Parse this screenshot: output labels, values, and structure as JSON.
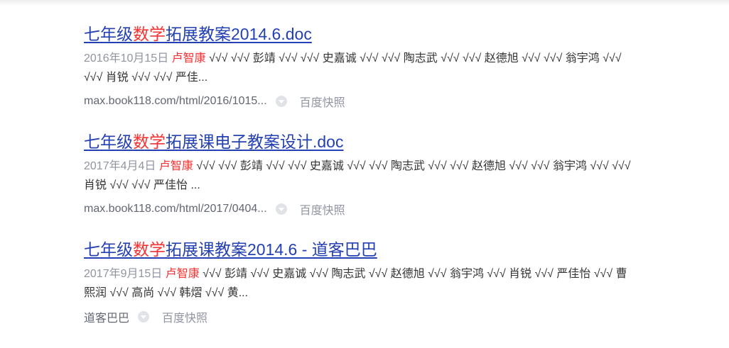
{
  "results": [
    {
      "title_pre": "七年级",
      "title_hl": "数学",
      "title_post": "拓展教案2014.6.doc",
      "date": "2016年10月15日",
      "author": "卢智康",
      "abstract": " √√√ √√√ 彭靖 √√√ √√√ 史嘉诚 √√√ √√√ 陶志武 √√√ √√√ 赵德旭 √√√ √√√ 翁宇鸿 √√√ √√√ 肖锐 √√√ √√√ 严佳...",
      "source": "max.book118.com/html/2016/1015...",
      "cache": "百度快照"
    },
    {
      "title_pre": "七年级",
      "title_hl": "数学",
      "title_post": "拓展课电子教案设计.doc",
      "date": "2017年4月4日",
      "author": "卢智康",
      "abstract": " √√√ √√√ 彭靖 √√√ √√√ 史嘉诚 √√√ √√√ 陶志武 √√√ √√√ 赵德旭 √√√ √√√ 翁宇鸿 √√√ √√√ 肖锐 √√√ √√√ 严佳怡 ...",
      "source": "max.book118.com/html/2017/0404...",
      "cache": "百度快照"
    },
    {
      "title_pre": "七年级",
      "title_hl": "数学",
      "title_post": "拓展课教案2014.6 - 道客巴巴",
      "date": "2017年9月15日",
      "author": "卢智康",
      "abstract": " √√√ 彭靖 √√√ 史嘉诚 √√√ 陶志武 √√√ 赵德旭 √√√ 翁宇鸿 √√√ 肖锐 √√√ 严佳怡 √√√ 曹熙润 √√√ 高尚 √√√ 韩熠 √√√ 黄...",
      "source": "道客巴巴",
      "cache": "百度快照"
    }
  ]
}
